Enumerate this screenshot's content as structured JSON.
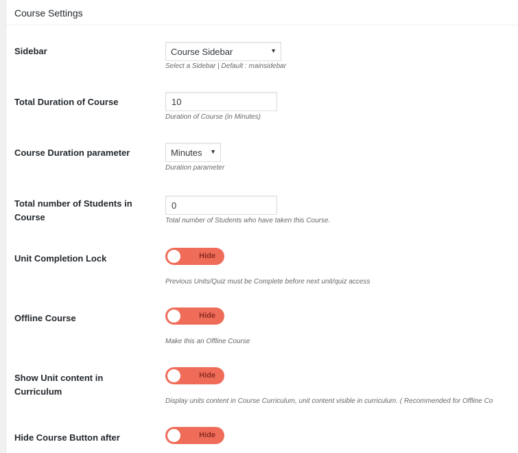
{
  "panel": {
    "title": "Course Settings"
  },
  "fields": {
    "sidebar": {
      "label": "Sidebar",
      "value": "Course Sidebar",
      "description": "Select a Sidebar | Default : mainsidebar"
    },
    "duration": {
      "label": "Total Duration of Course",
      "value": "10",
      "description": "Duration of Course (in Minutes)"
    },
    "duration_param": {
      "label": "Course Duration parameter",
      "value": "Minutes",
      "description": "Duration parameter"
    },
    "students": {
      "label": "Total number of Students in Course",
      "value": "0",
      "description": "Total number of Students who have taken this Course."
    },
    "unit_lock": {
      "label": "Unit Completion Lock",
      "toggle": "Hide",
      "description": "Previous Units/Quiz must be Complete before next unit/quiz access"
    },
    "offline": {
      "label": "Offline Course",
      "toggle": "Hide",
      "description": "Make this an Offline Course"
    },
    "unit_content": {
      "label": "Show Unit content in Curriculum",
      "toggle": "Hide",
      "description": "Display units content in Course Curriculum, unit content visible in curriculum. ( Recommended for Offline Co"
    },
    "hide_button": {
      "label": "Hide Course Button after",
      "toggle": "Hide"
    }
  },
  "colors": {
    "toggle_off": "#ef6c59",
    "toggle_text": "#8a2b1f"
  }
}
